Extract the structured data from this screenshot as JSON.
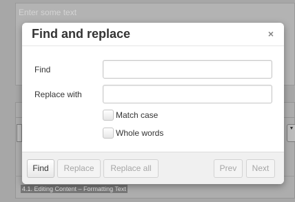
{
  "background": {
    "editor_placeholder": "Enter some text",
    "bottom_text": "4.1. Editing Content – Formatting Text"
  },
  "dialog": {
    "title": "Find and replace",
    "close_glyph": "×",
    "find_label": "Find",
    "find_value": "",
    "replace_label": "Replace with",
    "replace_value": "",
    "match_case_label": "Match case",
    "match_case_checked": false,
    "whole_words_label": "Whole words",
    "whole_words_checked": false
  },
  "footer": {
    "find_button": "Find",
    "replace_button": "Replace",
    "replace_all_button": "Replace all",
    "prev_button": "Prev",
    "next_button": "Next"
  },
  "colors": {
    "overlay": "#a7a7a7",
    "dialog_bg": "#ffffff",
    "footer_bg": "#f0f0f0",
    "disabled_text": "#a6a6a6"
  }
}
